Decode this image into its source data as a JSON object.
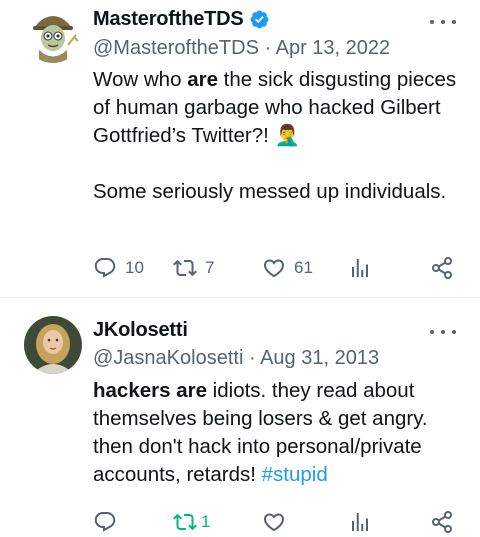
{
  "tweets": [
    {
      "name": "MasteroftheTDS",
      "handle": "@MasteroftheTDS",
      "separator": "·",
      "date": "Apr 13, 2022",
      "body": {
        "pre": "Wow who ",
        "bold": "are",
        "post": " the sick disgusting pieces of human garbage who hacked Gilbert Gottfried’s Twitter?! ",
        "emoji": "🤦‍♂️",
        "line2": "Some seriously messed up individuals."
      },
      "verified": true,
      "stats": {
        "replies": "10",
        "retweets": "7",
        "likes": "61"
      }
    },
    {
      "name": "JKolosetti",
      "handle": "@JasnaKolosetti",
      "separator": "·",
      "date": "Aug 31, 2013",
      "body": {
        "bold": "hackers are",
        "text": " idiots. they read about themselves being losers & get angry. then don't hack into personal/private accounts, retards! ",
        "hashtag": "#stupid"
      },
      "verified": false,
      "stats": {
        "replies": "",
        "retweets": "1",
        "likes": ""
      }
    }
  ],
  "colors": {
    "text": "#0f1419",
    "secondary": "#536471",
    "link": "#1d9bf0",
    "verified": "#1d9bf0",
    "retweeted": "#00ba7c",
    "divider": "#e6e9ec"
  }
}
